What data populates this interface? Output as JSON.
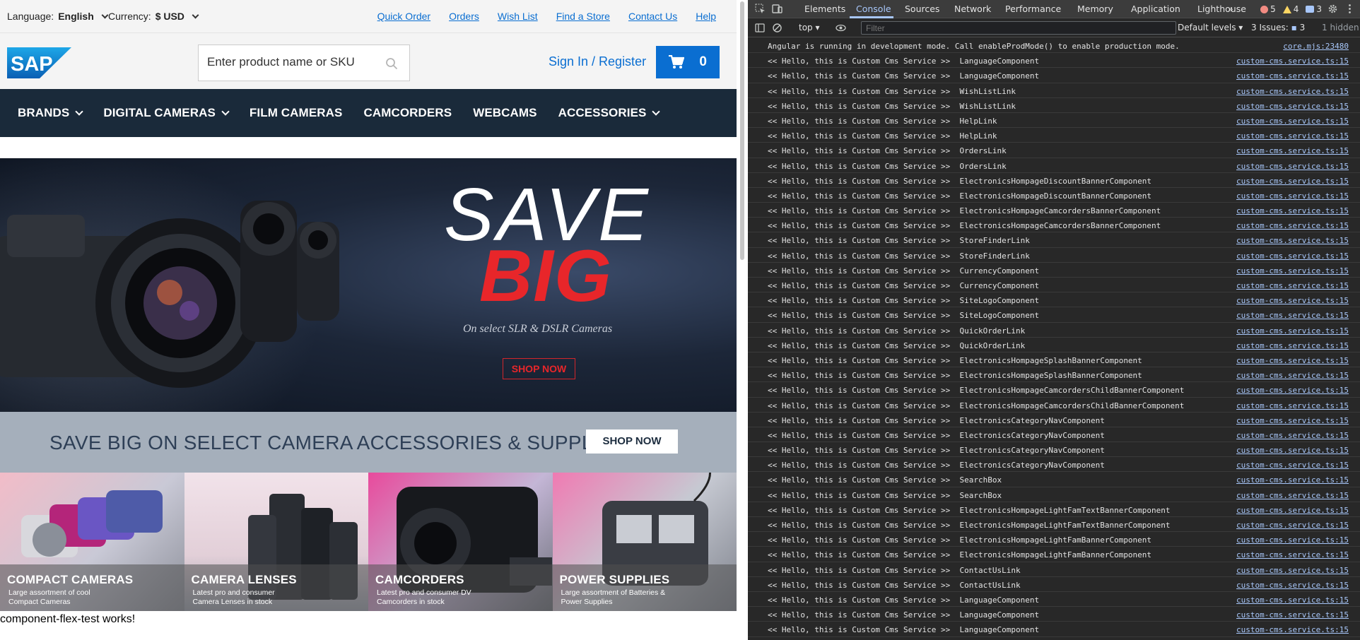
{
  "topbar": {
    "language_label": "Language:",
    "language_value": "English",
    "currency_label": "Currency:",
    "currency_value": "$ USD",
    "links": [
      "Quick Order",
      "Orders",
      "Wish List",
      "Find a Store",
      "Contact Us",
      "Help"
    ]
  },
  "header": {
    "logo_text": "SAP",
    "search_placeholder": "Enter product name or SKU",
    "signin": "Sign In / Register",
    "cart_count": "0"
  },
  "nav": {
    "items": [
      {
        "label": "BRANDS",
        "dropdown": true
      },
      {
        "label": "DIGITAL CAMERAS",
        "dropdown": true
      },
      {
        "label": "FILM CAMERAS",
        "dropdown": false
      },
      {
        "label": "CAMCORDERS",
        "dropdown": false
      },
      {
        "label": "WEBCAMS",
        "dropdown": false
      },
      {
        "label": "ACCESSORIES",
        "dropdown": true
      }
    ]
  },
  "hero": {
    "line1": "SAVE",
    "line2": "BIG",
    "subtitle": "On select SLR & DSLR Cameras",
    "button": "SHOP NOW"
  },
  "promo": {
    "text": "SAVE BIG ON SELECT CAMERA ACCESSORIES & SUPPLIES",
    "button": "SHOP NOW"
  },
  "tiles": [
    {
      "title": "COMPACT CAMERAS",
      "sub": "Large assortment of cool Compact Cameras"
    },
    {
      "title": "CAMERA LENSES",
      "sub": "Latest pro and consumer Camera Lenses in stock"
    },
    {
      "title": "CAMCORDERS",
      "sub": "Latest pro and consumer DV Camcorders in stock"
    },
    {
      "title": "POWER SUPPLIES",
      "sub": "Large assortment of Batteries & Power Supplies"
    }
  ],
  "footer_text": "component-flex-test works!",
  "devtools": {
    "tabs": [
      "Elements",
      "Console",
      "Sources",
      "Network",
      "Performance",
      "Memory",
      "Application",
      "Lighthouse"
    ],
    "active_tab": "Console",
    "errors": "5",
    "warnings": "4",
    "infos": "3",
    "context": "top",
    "filter_placeholder": "Filter",
    "levels": "Default levels",
    "issues": "3 Issues:",
    "issues_count": "3",
    "hidden": "1 hidden",
    "accent": "#a8c7fa",
    "console_rows": [
      {
        "msg": "Angular is running in development mode. Call enableProdMode() to enable production mode.",
        "src": "core.mjs:23480"
      },
      {
        "msg": "<< Hello, this is Custom Cms Service >>  LanguageComponent",
        "src": "custom-cms.service.ts:15"
      },
      {
        "msg": "<< Hello, this is Custom Cms Service >>  LanguageComponent",
        "src": "custom-cms.service.ts:15"
      },
      {
        "msg": "<< Hello, this is Custom Cms Service >>  WishListLink",
        "src": "custom-cms.service.ts:15"
      },
      {
        "msg": "<< Hello, this is Custom Cms Service >>  WishListLink",
        "src": "custom-cms.service.ts:15"
      },
      {
        "msg": "<< Hello, this is Custom Cms Service >>  HelpLink",
        "src": "custom-cms.service.ts:15"
      },
      {
        "msg": "<< Hello, this is Custom Cms Service >>  HelpLink",
        "src": "custom-cms.service.ts:15"
      },
      {
        "msg": "<< Hello, this is Custom Cms Service >>  OrdersLink",
        "src": "custom-cms.service.ts:15"
      },
      {
        "msg": "<< Hello, this is Custom Cms Service >>  OrdersLink",
        "src": "custom-cms.service.ts:15"
      },
      {
        "msg": "<< Hello, this is Custom Cms Service >>  ElectronicsHompageDiscountBannerComponent",
        "src": "custom-cms.service.ts:15"
      },
      {
        "msg": "<< Hello, this is Custom Cms Service >>  ElectronicsHompageDiscountBannerComponent",
        "src": "custom-cms.service.ts:15"
      },
      {
        "msg": "<< Hello, this is Custom Cms Service >>  ElectronicsHompageCamcordersBannerComponent",
        "src": "custom-cms.service.ts:15"
      },
      {
        "msg": "<< Hello, this is Custom Cms Service >>  ElectronicsHompageCamcordersBannerComponent",
        "src": "custom-cms.service.ts:15"
      },
      {
        "msg": "<< Hello, this is Custom Cms Service >>  StoreFinderLink",
        "src": "custom-cms.service.ts:15"
      },
      {
        "msg": "<< Hello, this is Custom Cms Service >>  StoreFinderLink",
        "src": "custom-cms.service.ts:15"
      },
      {
        "msg": "<< Hello, this is Custom Cms Service >>  CurrencyComponent",
        "src": "custom-cms.service.ts:15"
      },
      {
        "msg": "<< Hello, this is Custom Cms Service >>  CurrencyComponent",
        "src": "custom-cms.service.ts:15"
      },
      {
        "msg": "<< Hello, this is Custom Cms Service >>  SiteLogoComponent",
        "src": "custom-cms.service.ts:15"
      },
      {
        "msg": "<< Hello, this is Custom Cms Service >>  SiteLogoComponent",
        "src": "custom-cms.service.ts:15"
      },
      {
        "msg": "<< Hello, this is Custom Cms Service >>  QuickOrderLink",
        "src": "custom-cms.service.ts:15"
      },
      {
        "msg": "<< Hello, this is Custom Cms Service >>  QuickOrderLink",
        "src": "custom-cms.service.ts:15"
      },
      {
        "msg": "<< Hello, this is Custom Cms Service >>  ElectronicsHompageSplashBannerComponent",
        "src": "custom-cms.service.ts:15"
      },
      {
        "msg": "<< Hello, this is Custom Cms Service >>  ElectronicsHompageSplashBannerComponent",
        "src": "custom-cms.service.ts:15"
      },
      {
        "msg": "<< Hello, this is Custom Cms Service >>  ElectronicsHompageCamcordersChildBannerComponent",
        "src": "custom-cms.service.ts:15"
      },
      {
        "msg": "<< Hello, this is Custom Cms Service >>  ElectronicsHompageCamcordersChildBannerComponent",
        "src": "custom-cms.service.ts:15"
      },
      {
        "msg": "<< Hello, this is Custom Cms Service >>  ElectronicsCategoryNavComponent",
        "src": "custom-cms.service.ts:15"
      },
      {
        "msg": "<< Hello, this is Custom Cms Service >>  ElectronicsCategoryNavComponent",
        "src": "custom-cms.service.ts:15"
      },
      {
        "msg": "<< Hello, this is Custom Cms Service >>  ElectronicsCategoryNavComponent",
        "src": "custom-cms.service.ts:15"
      },
      {
        "msg": "<< Hello, this is Custom Cms Service >>  ElectronicsCategoryNavComponent",
        "src": "custom-cms.service.ts:15"
      },
      {
        "msg": "<< Hello, this is Custom Cms Service >>  SearchBox",
        "src": "custom-cms.service.ts:15"
      },
      {
        "msg": "<< Hello, this is Custom Cms Service >>  SearchBox",
        "src": "custom-cms.service.ts:15"
      },
      {
        "msg": "<< Hello, this is Custom Cms Service >>  ElectronicsHompageLightFamTextBannerComponent",
        "src": "custom-cms.service.ts:15"
      },
      {
        "msg": "<< Hello, this is Custom Cms Service >>  ElectronicsHompageLightFamTextBannerComponent",
        "src": "custom-cms.service.ts:15"
      },
      {
        "msg": "<< Hello, this is Custom Cms Service >>  ElectronicsHompageLightFamBannerComponent",
        "src": "custom-cms.service.ts:15"
      },
      {
        "msg": "<< Hello, this is Custom Cms Service >>  ElectronicsHompageLightFamBannerComponent",
        "src": "custom-cms.service.ts:15"
      },
      {
        "msg": "<< Hello, this is Custom Cms Service >>  ContactUsLink",
        "src": "custom-cms.service.ts:15"
      },
      {
        "msg": "<< Hello, this is Custom Cms Service >>  ContactUsLink",
        "src": "custom-cms.service.ts:15"
      },
      {
        "msg": "<< Hello, this is Custom Cms Service >>  LanguageComponent",
        "src": "custom-cms.service.ts:15"
      },
      {
        "msg": "<< Hello, this is Custom Cms Service >>  LanguageComponent",
        "src": "custom-cms.service.ts:15"
      },
      {
        "msg": "<< Hello, this is Custom Cms Service >>  LanguageComponent",
        "src": "custom-cms.service.ts:15"
      }
    ]
  }
}
